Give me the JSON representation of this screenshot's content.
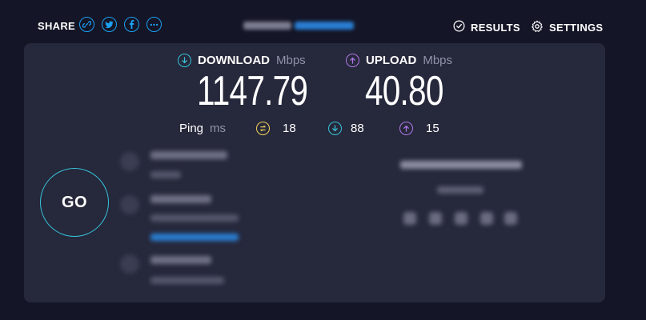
{
  "header": {
    "share_label": "SHARE",
    "share_icons": [
      "link-icon",
      "twitter-icon",
      "facebook-icon",
      "more-icon"
    ],
    "results_label": "RESULTS",
    "settings_label": "SETTINGS"
  },
  "download": {
    "label": "DOWNLOAD",
    "unit": "Mbps",
    "value": "1147.79"
  },
  "upload": {
    "label": "UPLOAD",
    "unit": "Mbps",
    "value": "40.80"
  },
  "ping": {
    "label": "Ping",
    "unit": "ms",
    "idle": "18",
    "download": "88",
    "upload": "15"
  },
  "go_label": "GO",
  "colors": {
    "download": "#36c3d8",
    "upload": "#b077e8",
    "idle": "#f2d35b",
    "link": "#1ca0f2",
    "go_ring": "#36c3d8"
  }
}
